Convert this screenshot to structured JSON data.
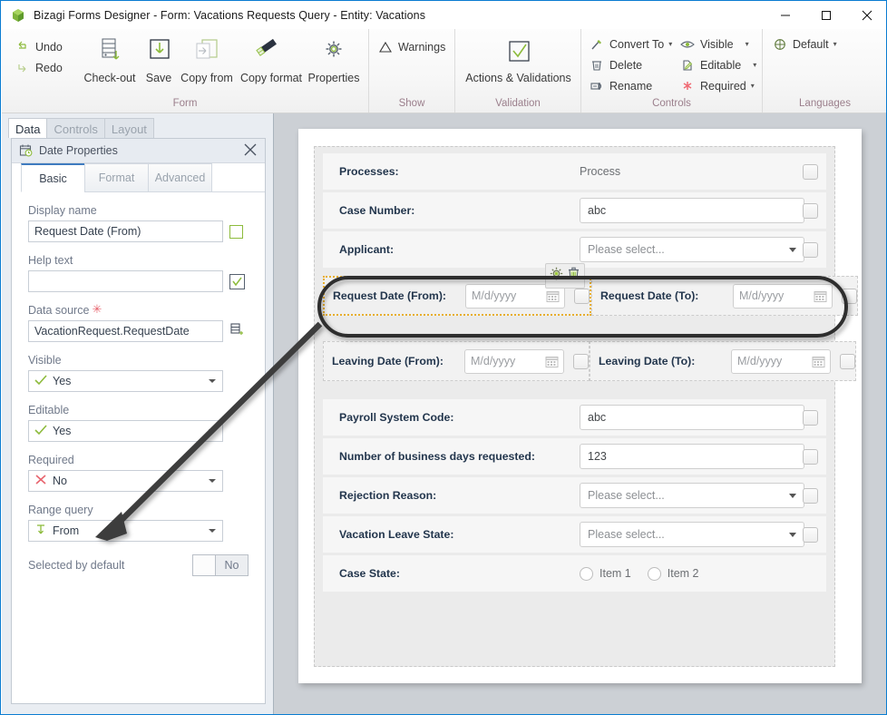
{
  "window": {
    "title": "Bizagi Forms Designer  - Form: Vacations Requests Query - Entity:  Vacations",
    "minimize": "–",
    "maximize": "□",
    "close": "✕"
  },
  "ribbon": {
    "groups": [
      {
        "name": "Form",
        "label": "Form",
        "small_buttons": [
          {
            "label": "Undo",
            "icon": "undo-icon"
          },
          {
            "label": "Redo",
            "icon": "redo-icon"
          }
        ],
        "big_buttons": [
          {
            "label": "Check-out",
            "icon": "check-out-icon"
          },
          {
            "label": "Save",
            "icon": "save-icon"
          },
          {
            "label": "Copy from",
            "icon": "copy-from-icon"
          },
          {
            "label": "Copy format",
            "icon": "copy-format-icon"
          },
          {
            "label": "Properties",
            "icon": "gear-icon"
          }
        ]
      },
      {
        "name": "Show",
        "label": "Show",
        "items": [
          {
            "label": "Warnings",
            "icon": "warning-triangle-icon"
          }
        ]
      },
      {
        "name": "Validation",
        "label": "Validation",
        "items": [
          {
            "label": "Actions & Validations",
            "icon": "check-box-icon"
          }
        ]
      },
      {
        "name": "Controls",
        "label": "Controls",
        "col1": [
          {
            "label": "Convert To",
            "icon": "convert-icon",
            "dropdown": true
          },
          {
            "label": "Delete",
            "icon": "trash-icon",
            "dropdown": false
          },
          {
            "label": "Rename",
            "icon": "rename-icon",
            "dropdown": false
          }
        ],
        "col2": [
          {
            "label": "Visible",
            "icon": "eye-icon",
            "dropdown": true
          },
          {
            "label": "Editable",
            "icon": "pencil-page-icon",
            "dropdown": true
          },
          {
            "label": "Required",
            "icon": "asterisk-icon",
            "dropdown": true
          }
        ]
      },
      {
        "name": "Languages",
        "label": "Languages",
        "items": [
          {
            "label": "Default",
            "icon": "globe-icon",
            "dropdown": true
          }
        ]
      }
    ]
  },
  "left_panel": {
    "tabs": [
      {
        "label": "Data",
        "active": true
      },
      {
        "label": "Controls",
        "active": false
      },
      {
        "label": "Layout",
        "active": false
      }
    ],
    "properties": {
      "header_title": "Date Properties",
      "header_icon": "date-properties-icon",
      "close_icon": "close-icon",
      "subtabs": [
        {
          "label": "Basic",
          "active": true
        },
        {
          "label": "Format",
          "active": false
        },
        {
          "label": "Advanced",
          "active": false
        }
      ],
      "fields": {
        "display_name_label": "Display name",
        "display_name_value": "Request Date (From)",
        "help_text_label": "Help text",
        "help_text_value": "",
        "data_source_label": "Data source",
        "data_source_required_marker": "✳",
        "data_source_value": "VacationRequest.RequestDate",
        "visible_label": "Visible",
        "visible_value": "Yes",
        "editable_label": "Editable",
        "editable_value": "Yes",
        "required_label": "Required",
        "required_value": "No",
        "range_query_label": "Range query",
        "range_query_value": "From",
        "selected_by_default_label": "Selected by default",
        "selected_by_default_value": "No"
      }
    }
  },
  "form_canvas": {
    "rows": [
      {
        "type": "static",
        "label": "Processes:",
        "value": "Process"
      },
      {
        "type": "text",
        "label": "Case Number:",
        "value": "abc"
      },
      {
        "type": "select",
        "label": "Applicant:",
        "value": "Please select..."
      },
      {
        "type": "daterange",
        "selected": true,
        "left": {
          "label": "Request Date (From):",
          "placeholder": "M/d/yyyy"
        },
        "right": {
          "label": "Request Date (To):",
          "placeholder": "M/d/yyyy"
        },
        "tools": [
          {
            "name": "gear-icon"
          },
          {
            "name": "trash-icon"
          }
        ]
      },
      {
        "type": "daterange",
        "selected": false,
        "left": {
          "label": "Leaving Date (From):",
          "placeholder": "M/d/yyyy"
        },
        "right": {
          "label": "Leaving Date (To):",
          "placeholder": "M/d/yyyy"
        }
      },
      {
        "type": "text",
        "label": "Payroll System Code:",
        "value": "abc"
      },
      {
        "type": "text",
        "label": "Number of business days requested:",
        "value": "123"
      },
      {
        "type": "select",
        "label": "Rejection Reason:",
        "value": "Please select..."
      },
      {
        "type": "select",
        "label": "Vacation Leave State:",
        "value": "Please select..."
      },
      {
        "type": "radio",
        "label": "Case State:",
        "options": [
          "Item 1",
          "Item 2"
        ]
      }
    ]
  },
  "colors": {
    "accent_blue": "#0a7cd1",
    "ribbon_group_label": "#9b7f8c",
    "green_icon": "#8dbb3c",
    "selection_gold": "#e7ae2e",
    "required_red": "#e8646e",
    "canvas_gray": "#ccd0d5",
    "annotation_black": "#3a3a3a"
  }
}
